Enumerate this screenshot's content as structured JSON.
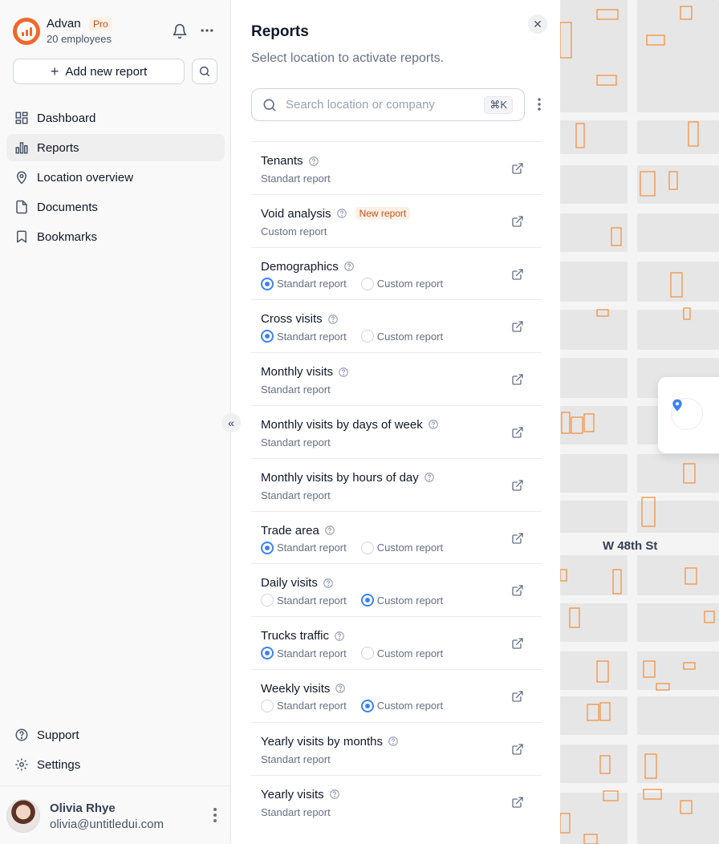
{
  "brand": {
    "name": "Advan",
    "plan": "Pro",
    "employees": "20 employees"
  },
  "actions": {
    "add_report": "Add new report"
  },
  "nav": {
    "items": [
      {
        "label": "Dashboard",
        "icon": "dashboard-icon"
      },
      {
        "label": "Reports",
        "icon": "bar-chart-icon",
        "active": true
      },
      {
        "label": "Location overview",
        "icon": "map-pin-icon"
      },
      {
        "label": "Documents",
        "icon": "document-icon"
      },
      {
        "label": "Bookmarks",
        "icon": "bookmark-icon"
      }
    ],
    "footer": [
      {
        "label": "Support",
        "icon": "help-circle-icon"
      },
      {
        "label": "Settings",
        "icon": "gear-icon"
      }
    ]
  },
  "user": {
    "name": "Olivia Rhye",
    "email": "olivia@untitledui.com"
  },
  "panel": {
    "title": "Reports",
    "subtitle": "Select location to activate reports.",
    "search_placeholder": "Search location or company",
    "shortcut": "⌘K",
    "new_badge": "New report",
    "reports": [
      {
        "title": "Tenants",
        "type": "Standart report"
      },
      {
        "title": "Void analysis",
        "type": "Custom report",
        "badge": true
      },
      {
        "title": "Demographics",
        "selected": "standard"
      },
      {
        "title": "Cross visits",
        "selected": "standard"
      },
      {
        "title": "Monthly visits",
        "type": "Standart report"
      },
      {
        "title": "Monthly visits by days of week",
        "type": "Standart report"
      },
      {
        "title": "Monthly visits by hours of day",
        "type": "Standart report"
      },
      {
        "title": "Trade area",
        "selected": "standard"
      },
      {
        "title": "Daily visits",
        "selected": "custom"
      },
      {
        "title": "Trucks traffic",
        "selected": "standard"
      },
      {
        "title": "Weekly visits",
        "selected": "custom"
      },
      {
        "title": "Yearly visits by months",
        "type": "Standart report"
      },
      {
        "title": "Yearly visits",
        "type": "Standart report"
      }
    ],
    "radio_labels": {
      "standard": "Standart report",
      "custom": "Custom report"
    }
  },
  "map": {
    "street": "W 48th St"
  },
  "colors": {
    "accent": "#3b82f6",
    "brand": "#f0682a",
    "building_outline": "#f28c38"
  }
}
